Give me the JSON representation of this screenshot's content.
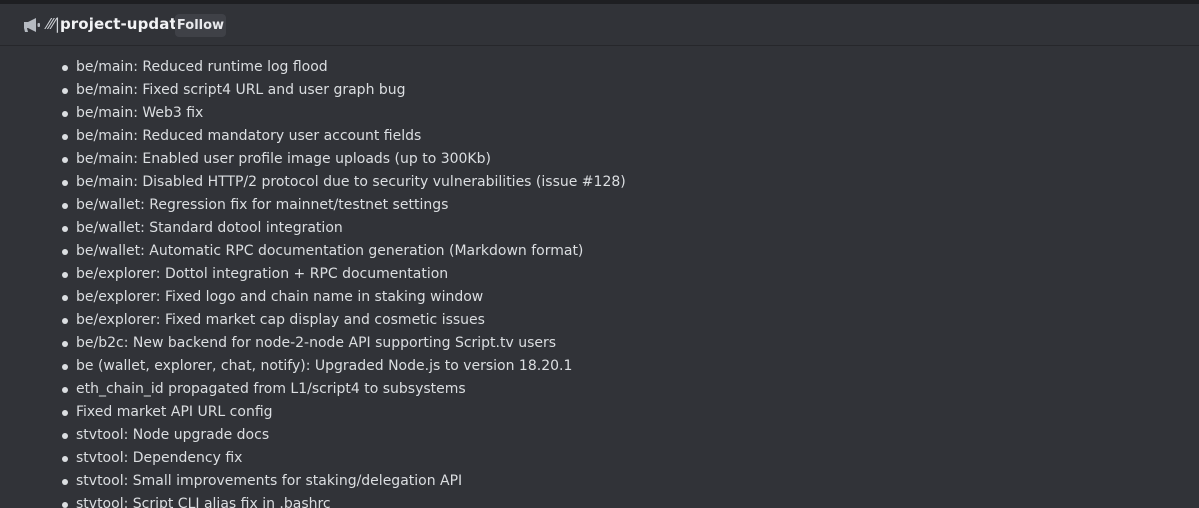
{
  "header": {
    "channel_prefix": "⁄⁄⁄|",
    "channel_name": "project-updates",
    "follow_label": "Follow"
  },
  "updates": [
    "be/main: Reduced runtime log flood",
    "be/main: Fixed script4 URL and user graph bug",
    "be/main: Web3 fix",
    "be/main: Reduced mandatory user account fields",
    "be/main: Enabled user profile image uploads (up to 300Kb)",
    "be/main: Disabled HTTP/2 protocol due to security vulnerabilities (issue #128)",
    "be/wallet: Regression fix for mainnet/testnet settings",
    "be/wallet: Standard dotool integration",
    "be/wallet: Automatic RPC documentation generation (Markdown format)",
    "be/explorer: Dottol integration + RPC documentation",
    "be/explorer: Fixed logo and chain name in staking window",
    "be/explorer: Fixed market cap display and cosmetic issues",
    "be/b2c: New backend for node-2-node API supporting Script.tv users",
    "be (wallet, explorer, chat, notify): Upgraded Node.js to version 18.20.1",
    "eth_chain_id propagated from L1/script4 to subsystems",
    "Fixed market API URL config",
    "stvtool: Node upgrade docs",
    "stvtool: Dependency fix",
    "stvtool: Small improvements for staking/delegation API",
    "stvtool: Script CLI alias fix in .bashrc"
  ]
}
